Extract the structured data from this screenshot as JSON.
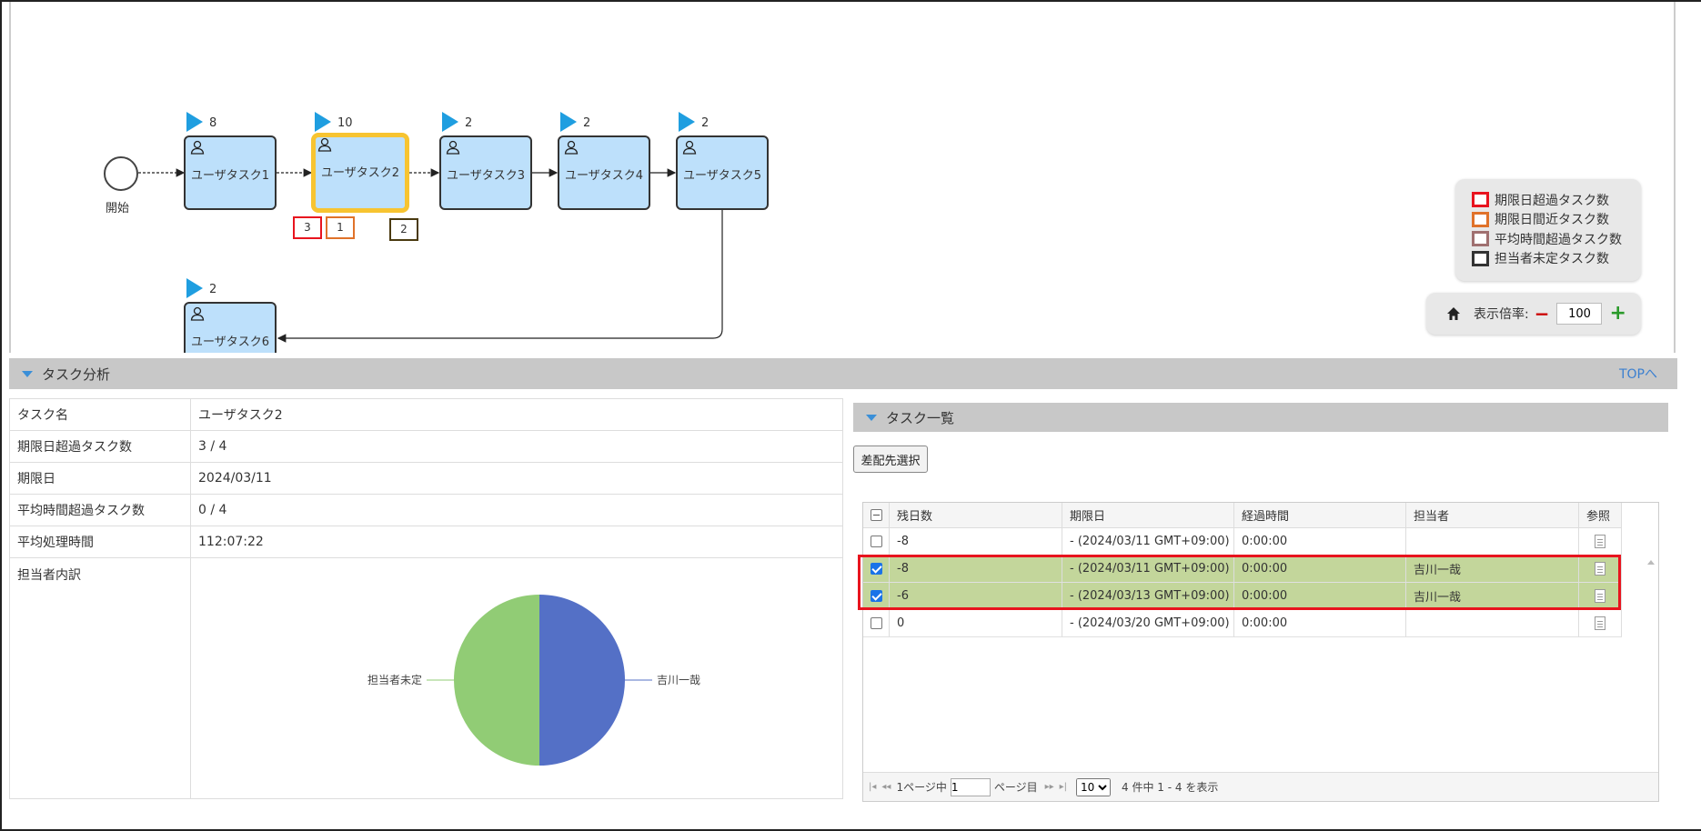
{
  "diagram": {
    "start_label": "開始",
    "tasks": [
      {
        "label": "ユーザタスク1",
        "count": "8"
      },
      {
        "label": "ユーザタスク2",
        "count": "10"
      },
      {
        "label": "ユーザタスク3",
        "count": "2"
      },
      {
        "label": "ユーザタスク4",
        "count": "2"
      },
      {
        "label": "ユーザタスク5",
        "count": "2"
      },
      {
        "label": "ユーザタスク6",
        "count": "2"
      }
    ],
    "badges": {
      "overdue": "3",
      "near_due": "1",
      "unassigned": "2"
    },
    "legend": [
      {
        "label": "期限日超過タスク数",
        "color": "#e8141e"
      },
      {
        "label": "期限日間近タスク数",
        "color": "#e0722a"
      },
      {
        "label": "平均時間超過タスク数",
        "color": "#a07070"
      },
      {
        "label": "担当者未定タスク数",
        "color": "#333333"
      }
    ],
    "zoom": {
      "label": "表示倍率:",
      "value": "100"
    }
  },
  "analysis": {
    "title": "タスク分析",
    "top_link": "TOPへ",
    "rows": [
      {
        "key": "タスク名",
        "value": "ユーザタスク2"
      },
      {
        "key": "期限日超過タスク数",
        "value": "3 / 4"
      },
      {
        "key": "期限日",
        "value": "2024/03/11"
      },
      {
        "key": "平均時間超過タスク数",
        "value": "0 / 4"
      },
      {
        "key": "平均処理時間",
        "value": "112:07:22"
      }
    ],
    "assignee_label": "担当者内訳"
  },
  "chart_data": {
    "type": "pie",
    "categories": [
      "吉川一哉",
      "担当者未定"
    ],
    "values": [
      2,
      2
    ],
    "colors": [
      "#5470c6",
      "#91cc75"
    ]
  },
  "task_list": {
    "title": "タスク一覧",
    "button": "差配先選択",
    "columns": [
      "残日数",
      "期限日",
      "経過時間",
      "担当者",
      "参照"
    ],
    "rows": [
      {
        "days": "-8",
        "due": "- (2024/03/11 GMT+09:00)",
        "elapsed": "0:00:00",
        "assignee": "",
        "checked": false
      },
      {
        "days": "-8",
        "due": "- (2024/03/11 GMT+09:00)",
        "elapsed": "0:00:00",
        "assignee": "吉川一哉",
        "checked": true
      },
      {
        "days": "-6",
        "due": "- (2024/03/13 GMT+09:00)",
        "elapsed": "0:00:00",
        "assignee": "吉川一哉",
        "checked": true
      },
      {
        "days": "0",
        "due": "- (2024/03/20 GMT+09:00)",
        "elapsed": "0:00:00",
        "assignee": "",
        "checked": false
      }
    ],
    "pager": {
      "prefix": "1ページ中",
      "page": "1",
      "suffix": "ページ目",
      "per_page": "10",
      "summary": "4 件中 1 - 4 を表示"
    }
  }
}
